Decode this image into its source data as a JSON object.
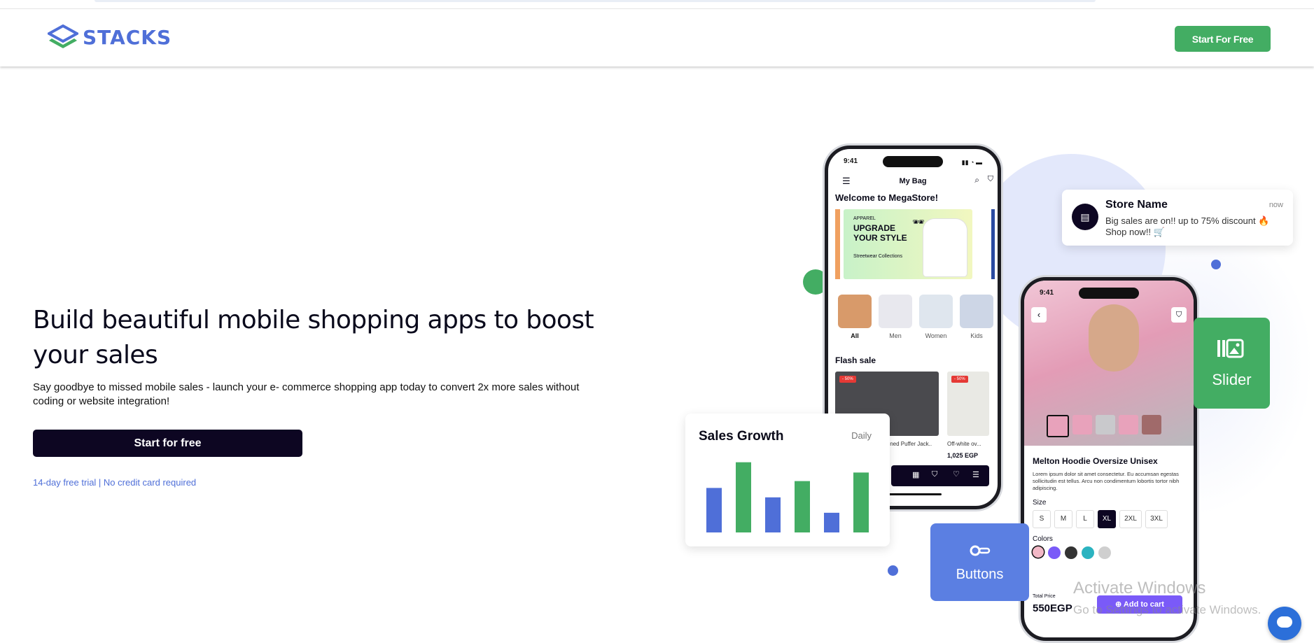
{
  "brand": {
    "name": "STACKS",
    "logo_colors": [
      "#4f6fd8",
      "#43ad63"
    ]
  },
  "header": {
    "cta_label": "Start For Free"
  },
  "hero": {
    "title": "Build beautiful mobile shopping apps to boost your sales",
    "subtitle": "Say goodbye to missed mobile sales - launch your e- commerce shopping app today to convert 2x more sales without coding or website integration!",
    "cta_label": "Start for free",
    "trial_note": "14-day free trial | No credit card required"
  },
  "phone_bag": {
    "time": "9:41",
    "title": "My Bag",
    "welcome": "Welcome to MegaStore!",
    "banner": {
      "tag": "APPAREL",
      "headline": "UPGRADE YOUR STYLE",
      "caption": "Streetwear Collections"
    },
    "categories": [
      "All",
      "Men",
      "Women",
      "Kids"
    ],
    "flash_sale": "Flash sale",
    "products": [
      {
        "badge": "- 50%",
        "name": "Lined Puffer Jack..",
        "price": ""
      },
      {
        "badge": "- 50%",
        "name": "Off-white ov...",
        "price": "1,025 EGP"
      }
    ]
  },
  "notification": {
    "title": "Store Name",
    "time": "now",
    "message": "Big sales are on!! up to 75% discount 🔥 Shop now!! 🛒"
  },
  "sales_card": {
    "title": "Sales Growth",
    "period": "Daily",
    "bars": [
      {
        "value": 52,
        "color": "#4f6fd8"
      },
      {
        "value": 82,
        "color": "#43ad63"
      },
      {
        "value": 41,
        "color": "#4f6fd8"
      },
      {
        "value": 60,
        "color": "#43ad63"
      },
      {
        "value": 23,
        "color": "#4f6fd8"
      },
      {
        "value": 70,
        "color": "#43ad63"
      }
    ]
  },
  "phone_product": {
    "time": "9:41",
    "name": "Melton Hoodie Oversize Unisex",
    "description": "Lorem ipsum dolor sit amet consectetur. Eu accumsan egestas sollicitudin est tellus. Arcu non condimentum lobortis tortor nibh adipiscing.",
    "size_label": "Size",
    "sizes": [
      "S",
      "M",
      "L",
      "XL",
      "2XL",
      "3XL"
    ],
    "selected_size": "XL",
    "colors_label": "Colors",
    "colors": [
      "#f2b8c6",
      "#7a5af8",
      "#333333",
      "#2bb3c0",
      "#cfcfcf"
    ],
    "total_label": "Total Price",
    "total": "550EGP",
    "add_label": "Add to cart"
  },
  "features": {
    "slider": "Slider",
    "buttons": "Buttons"
  },
  "watermark": {
    "line1": "Activate Windows",
    "line2": "Go to Settings to activate Windows."
  },
  "accent": {
    "green": "#43ad63",
    "blue": "#4f6fd8",
    "dark": "#0d0622"
  }
}
